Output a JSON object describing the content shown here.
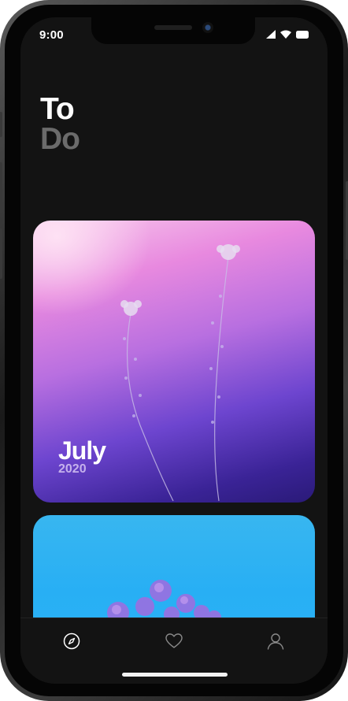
{
  "status_bar": {
    "time": "9:00"
  },
  "header": {
    "title_line1": "To",
    "title_line2": "Do"
  },
  "cards": [
    {
      "month": "July",
      "year": "2020"
    }
  ],
  "tab_bar": {
    "items": [
      "explore",
      "favorites",
      "profile"
    ],
    "active": "explore"
  },
  "colors": {
    "background": "#131313",
    "title_primary": "#ffffff",
    "title_secondary": "#6b6b6b",
    "tab_active": "#ffffff",
    "tab_inactive": "#8a8a8a"
  }
}
